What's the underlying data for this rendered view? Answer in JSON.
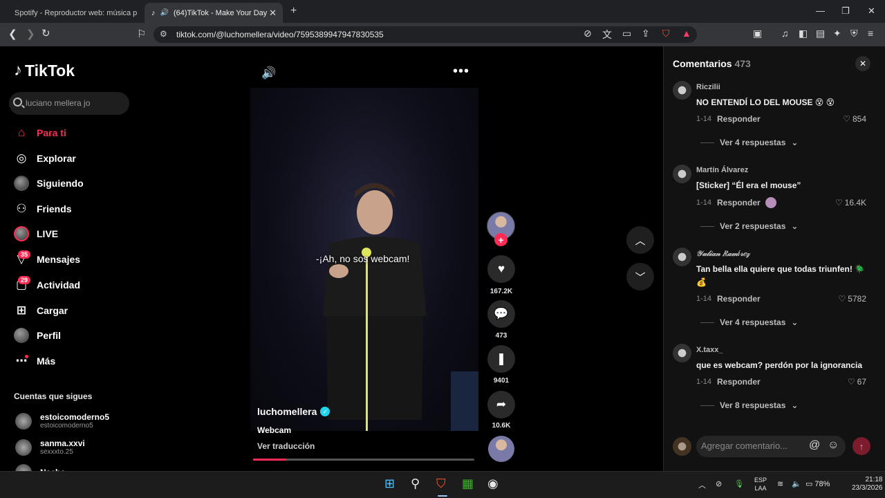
{
  "browser": {
    "tabs": [
      {
        "label": "Spotify - Reproductor web: música p"
      },
      {
        "label": "(64)TikTok - Make Your Day"
      }
    ],
    "url": "tiktok.com/@luchomellera/video/7595389947947830535"
  },
  "sidebar": {
    "logo": "TikTok",
    "search_value": "luciano mellera jo",
    "items": [
      {
        "label": "Para ti",
        "icon": "home-icon"
      },
      {
        "label": "Explorar",
        "icon": "compass-icon"
      },
      {
        "label": "Siguiendo",
        "icon": "following-avatar-icon"
      },
      {
        "label": "Friends",
        "icon": "friends-icon"
      },
      {
        "label": "LIVE",
        "icon": "live-icon"
      },
      {
        "label": "Mensajes",
        "icon": "messages-icon",
        "badge": "35"
      },
      {
        "label": "Actividad",
        "icon": "activity-icon",
        "badge": "29"
      },
      {
        "label": "Cargar",
        "icon": "upload-icon"
      },
      {
        "label": "Perfil",
        "icon": "profile-avatar-icon"
      },
      {
        "label": "Más",
        "icon": "more-icon"
      }
    ],
    "following_title": "Cuentas que sigues",
    "following": [
      {
        "name": "estoicomoderno5",
        "handle": "estoicomoderno5"
      },
      {
        "name": "sanma.xxvi",
        "handle": "sexxxto.25"
      },
      {
        "name": "Nacho",
        "handle": ""
      }
    ]
  },
  "video": {
    "subtitle": "-¡Ah, no sos webcam!",
    "author": "luchomellera",
    "description": "Webcam",
    "translate": "Ver traducción",
    "progress": 0.15,
    "likes": "167.2K",
    "comments": "473",
    "saves": "9401",
    "shares": "10.6K"
  },
  "comments_panel": {
    "title": "Comentarios",
    "count": "473",
    "reply_label": "Responder",
    "input_placeholder": "Agregar comentario...",
    "comments": [
      {
        "user": "Riczilii",
        "text": "NO ENTENDÍ LO DEL MOUSE 😵 😵",
        "date": "1-14",
        "likes": "854",
        "more": "Ver 4 respuestas"
      },
      {
        "user": "Martín Álvarez",
        "text": "[Sticker] “Él era el mouse”",
        "date": "1-14",
        "likes": "16.4K",
        "more": "Ver 2 respuestas"
      },
      {
        "user": "𝒴𝓊𝓁𝒾𝒶𝓃 𝑅𝒶𝓂í𝓇𝑒𝓏",
        "text": "Tan bella ella quiere que todas triunfen! 🪲 💰",
        "date": "1-14",
        "likes": "5782",
        "more": "Ver 4 respuestas"
      },
      {
        "user": "X.taxx_",
        "text": "que es webcam? perdón por la ignorancia",
        "date": "1-14",
        "likes": "67",
        "more": "Ver 8 respuestas"
      }
    ]
  },
  "taskbar": {
    "lang": "ESP",
    "lang2": "LAA",
    "battery": "78%",
    "time": "21:18",
    "date": "23/3/2026"
  },
  "colors": {
    "accent": "#fe2c55",
    "verified": "#20d5ec"
  }
}
